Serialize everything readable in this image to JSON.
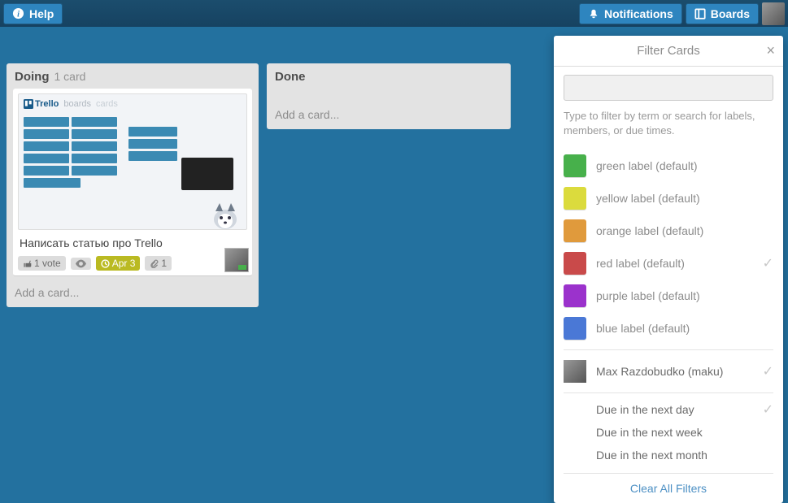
{
  "header": {
    "help": "Help",
    "notifications": "Notifications",
    "boards": "Boards"
  },
  "lists": [
    {
      "title": "Doing",
      "count": "1 card",
      "card": {
        "cover_logo": "Trello",
        "title": "Написать статью про Trello",
        "votes": "1 vote",
        "date": "Apr 3",
        "attachments": "1"
      },
      "add": "Add a card..."
    },
    {
      "title": "Done",
      "add": "Add a card..."
    }
  ],
  "filter": {
    "title": "Filter Cards",
    "hint": "Type to filter by term or search for labels, members, or due times.",
    "labels": [
      {
        "name": "green label (default)",
        "color": "#47b04b"
      },
      {
        "name": "yellow label (default)",
        "color": "#dbdb3d"
      },
      {
        "name": "orange label (default)",
        "color": "#e09a3c"
      },
      {
        "name": "red label (default)",
        "color": "#c94a4a",
        "selected": true
      },
      {
        "name": "purple label (default)",
        "color": "#9b32cc"
      },
      {
        "name": "blue label (default)",
        "color": "#4a78d6"
      }
    ],
    "member": "Max Razdobudko (maku)",
    "due": [
      {
        "label": "Due in the next day",
        "selected": true
      },
      {
        "label": "Due in the next week"
      },
      {
        "label": "Due in the next month"
      }
    ],
    "clear": "Clear All Filters"
  }
}
